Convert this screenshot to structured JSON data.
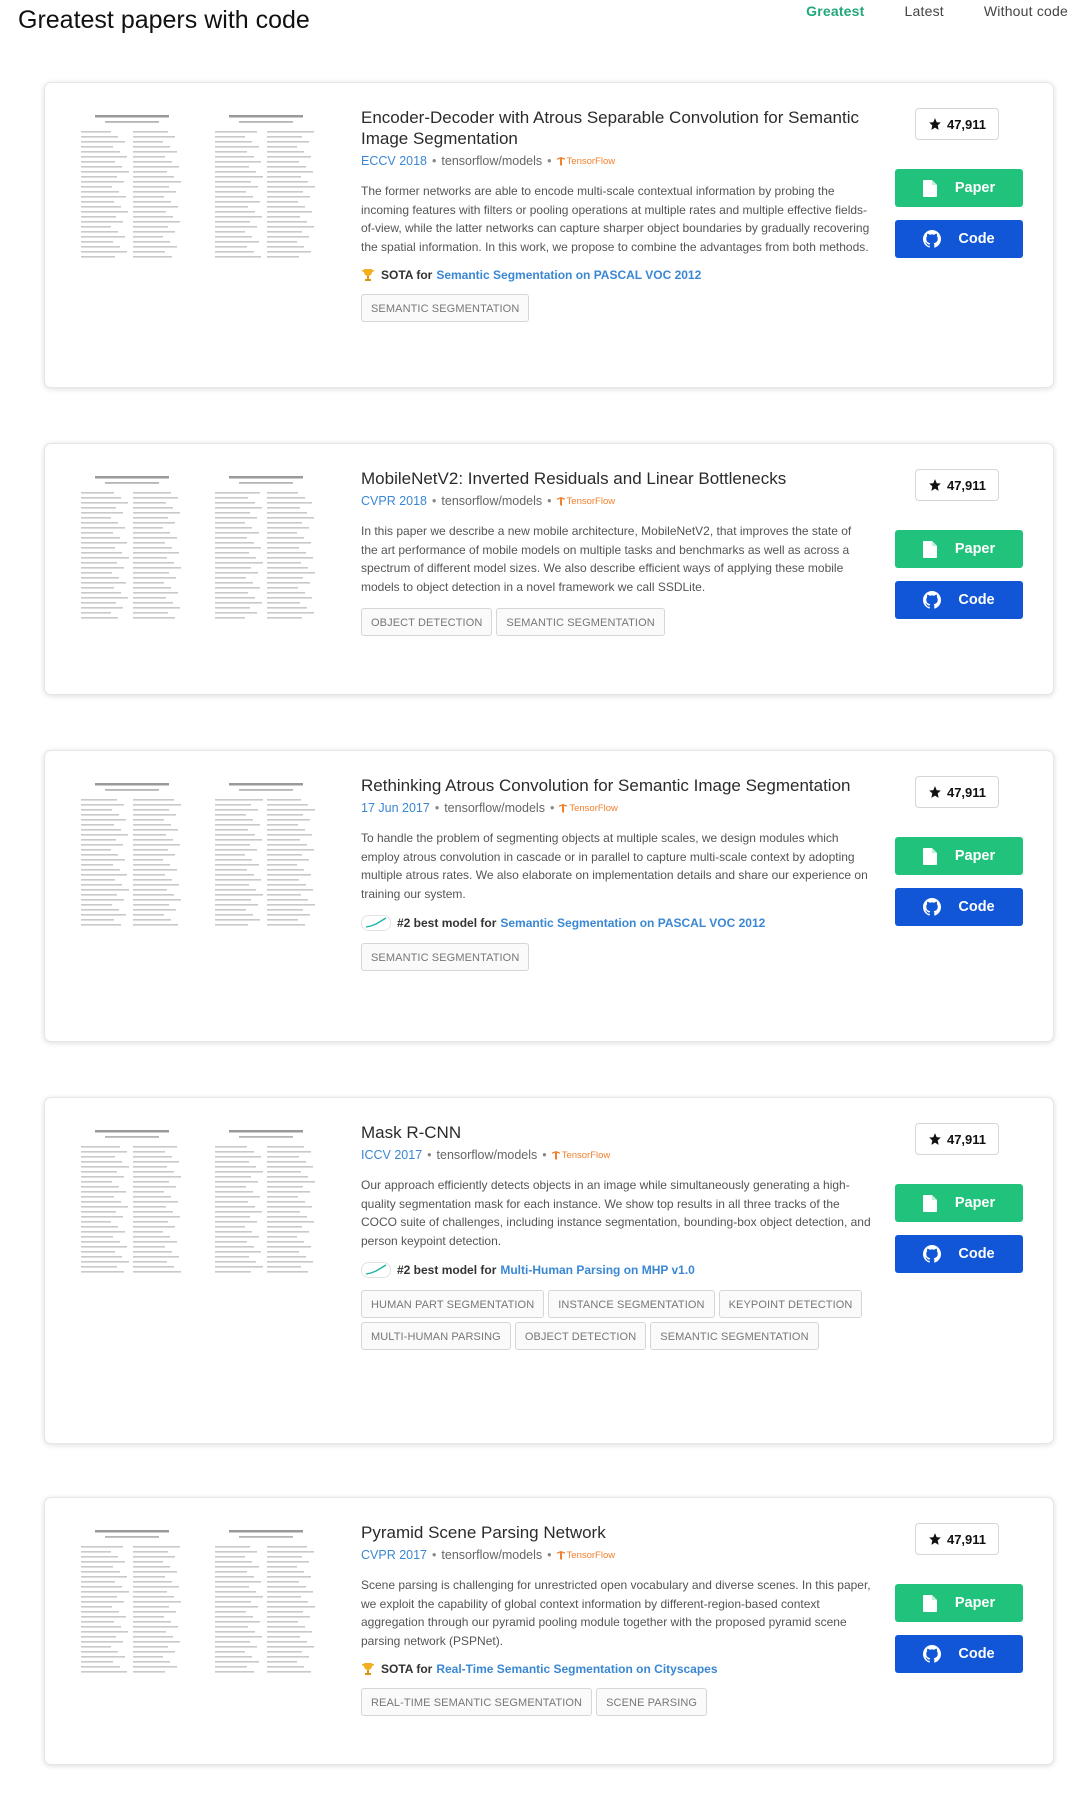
{
  "header": {
    "title": "Greatest papers with code",
    "tabs": [
      {
        "label": "Greatest",
        "active": true
      },
      {
        "label": "Latest",
        "active": false
      },
      {
        "label": "Without code",
        "active": false
      }
    ]
  },
  "colors": {
    "accent_green": "#21a77b",
    "paper_button": "#21c27b",
    "code_button": "#1156d6",
    "link_blue": "#3a87d3",
    "tensorflow_orange": "#f1802d"
  },
  "button_labels": {
    "paper": "Paper",
    "code": "Code"
  },
  "papers": [
    {
      "title": "Encoder-Decoder with Atrous Separable Convolution for Semantic Image Segmentation",
      "venue": "ECCV 2018",
      "repo": "tensorflow/models",
      "framework": "TensorFlow",
      "abstract": "The former networks are able to encode multi-scale contextual information by probing the incoming features with filters or pooling operations at multiple rates and multiple effective fields-of-view, while the latter networks can capture sharper object boundaries by gradually recovering the spatial information. In this work, we propose to combine the advantages from both methods.",
      "rank_icon": "trophy-icon",
      "rank_prefix": "SOTA for",
      "rank_task": "Semantic Segmentation on PASCAL VOC 2012",
      "tags": [
        "SEMANTIC SEGMENTATION"
      ],
      "stars": "47,911"
    },
    {
      "title": "MobileNetV2: Inverted Residuals and Linear Bottlenecks",
      "venue": "CVPR 2018",
      "repo": "tensorflow/models",
      "framework": "TensorFlow",
      "abstract": "In this paper we describe a new mobile architecture, MobileNetV2, that improves the state of the art performance of mobile models on multiple tasks and benchmarks as well as across a spectrum of different model sizes. We also describe efficient ways of applying these mobile models to object detection in a novel framework we call SSDLite.",
      "tags": [
        "OBJECT DETECTION",
        "SEMANTIC SEGMENTATION"
      ],
      "stars": "47,911"
    },
    {
      "title": "Rethinking Atrous Convolution for Semantic Image Segmentation",
      "venue": "17 Jun 2017",
      "repo": "tensorflow/models",
      "framework": "TensorFlow",
      "abstract": "To handle the problem of segmenting objects at multiple scales, we design modules which employ atrous convolution in cascade or in parallel to capture multi-scale context by adopting multiple atrous rates. We also elaborate on implementation details and share our experience on training our system.",
      "rank_icon": "sparkline-icon",
      "rank_prefix": "#2 best model for",
      "rank_task": "Semantic Segmentation on PASCAL VOC 2012",
      "tags": [
        "SEMANTIC SEGMENTATION"
      ],
      "stars": "47,911"
    },
    {
      "title": "Mask R-CNN",
      "venue": "ICCV 2017",
      "repo": "tensorflow/models",
      "framework": "TensorFlow",
      "abstract": "Our approach efficiently detects objects in an image while simultaneously generating a high-quality segmentation mask for each instance. We show top results in all three tracks of the COCO suite of challenges, including instance segmentation, bounding-box object detection, and person keypoint detection.",
      "rank_icon": "sparkline-icon",
      "rank_prefix": "#2 best model for",
      "rank_task": "Multi-Human Parsing on MHP v1.0",
      "tags": [
        "HUMAN PART SEGMENTATION",
        "INSTANCE SEGMENTATION",
        "KEYPOINT DETECTION",
        "MULTI-HUMAN PARSING",
        "OBJECT DETECTION",
        "SEMANTIC SEGMENTATION"
      ],
      "stars": "47,911"
    },
    {
      "title": "Pyramid Scene Parsing Network",
      "venue": "CVPR 2017",
      "repo": "tensorflow/models",
      "framework": "TensorFlow",
      "abstract": "Scene parsing is challenging for unrestricted open vocabulary and diverse scenes. In this paper, we exploit the capability of global context information by different-region-based context aggregation through our pyramid pooling module together with the proposed pyramid scene parsing network (PSPNet).",
      "rank_icon": "trophy-icon",
      "rank_prefix": "SOTA for",
      "rank_task": "Real-Time Semantic Segmentation on Cityscapes",
      "tags": [
        "REAL-TIME SEMANTIC SEGMENTATION",
        "SCENE PARSING"
      ],
      "stars": "47,911"
    }
  ]
}
